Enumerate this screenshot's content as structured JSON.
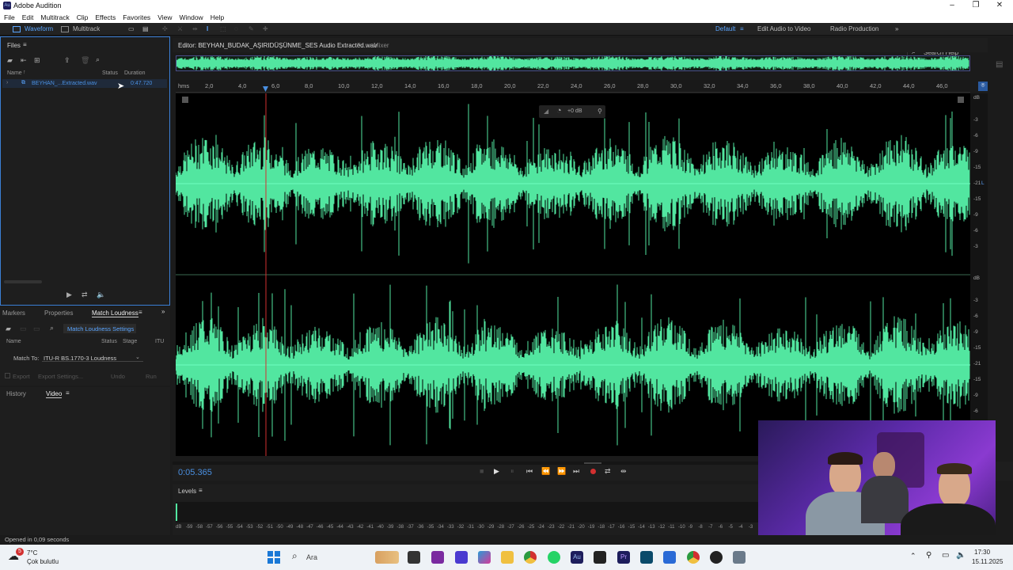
{
  "app": {
    "title": "Adobe Audition"
  },
  "menu": [
    "File",
    "Edit",
    "Multitrack",
    "Clip",
    "Effects",
    "Favorites",
    "View",
    "Window",
    "Help"
  ],
  "toolbar": {
    "waveform": "Waveform",
    "multitrack": "Multitrack",
    "workspace": "Default",
    "edit_audio_video": "Edit Audio to Video",
    "radio": "Radio Production",
    "search": "Search Help"
  },
  "files": {
    "title": "Files",
    "col_name": "Name",
    "col_status": "Status",
    "col_duration": "Duration",
    "item_name": "BEYHAN_...Extracted.wav",
    "item_duration": "0:47.720"
  },
  "panel2": {
    "tab_markers": "Markers",
    "tab_properties": "Properties",
    "tab_match": "Match Loudness",
    "settings_btn": "Match Loudness Settings",
    "col_name": "Name",
    "col_status": "Status",
    "col_stage": "Stage",
    "col_itu": "ITU",
    "match_to_label": "Match To:",
    "match_to_value": "ITU-R BS.1770-3 Loudness",
    "export": "Export",
    "export_settings": "Export Settings...",
    "undo": "Undo",
    "run": "Run"
  },
  "panel3": {
    "tab_history": "History",
    "tab_video": "Video"
  },
  "editor": {
    "title": "Editor: BEYHAN_BUDAK_AŞIRIDÜŞÜNME_SES Audio Extracted.wav",
    "mixer": "Mixer",
    "hud_gain": "+0 dB"
  },
  "ruler": {
    "unit": "hms",
    "ticks": [
      "2,0",
      "4,0",
      "6,0",
      "8,0",
      "10,0",
      "12,0",
      "14,0",
      "16,0",
      "18,0",
      "20,0",
      "22,0",
      "24,0",
      "26,0",
      "28,0",
      "30,0",
      "32,0",
      "34,0",
      "36,0",
      "38,0",
      "40,0",
      "42,0",
      "44,0",
      "46,0"
    ]
  },
  "db_scale": {
    "label": "dB",
    "top": [
      "-3",
      "-6",
      "-9",
      "-15",
      "-21",
      "-15",
      "-9",
      "-6",
      "-3"
    ],
    "bottom": [
      "-3",
      "-6",
      "-9",
      "-15",
      "-21",
      "-15",
      "-9",
      "-6"
    ],
    "channel_l": "L"
  },
  "transport": {
    "time": "0:05.365"
  },
  "levels": {
    "title": "Levels",
    "scale": [
      "dB",
      "-59",
      "-58",
      "-57",
      "-56",
      "-55",
      "-54",
      "-53",
      "-52",
      "-51",
      "-50",
      "-49",
      "-48",
      "-47",
      "-46",
      "-45",
      "-44",
      "-43",
      "-42",
      "-41",
      "-40",
      "-39",
      "-38",
      "-37",
      "-36",
      "-35",
      "-34",
      "-33",
      "-32",
      "-31",
      "-30",
      "-29",
      "-28",
      "-27",
      "-26",
      "-25",
      "-24",
      "-23",
      "-22",
      "-21",
      "-20",
      "-19",
      "-18",
      "-17",
      "-16",
      "-15",
      "-14",
      "-13",
      "-12",
      "-11",
      "-10",
      "-9",
      "-8",
      "-7",
      "-6",
      "-5",
      "-4",
      "-3",
      "-2"
    ]
  },
  "status": {
    "text": "Opened in 0,09 seconds"
  },
  "taskbar": {
    "temp": "7°C",
    "weather": "Çok bulutlu",
    "badge": "5",
    "search": "Ara",
    "time": "17:30",
    "date": "15.11.2025"
  },
  "colors": {
    "wave": "#52e6a0",
    "accent": "#5aa5ff",
    "playhead": "#d23030"
  }
}
